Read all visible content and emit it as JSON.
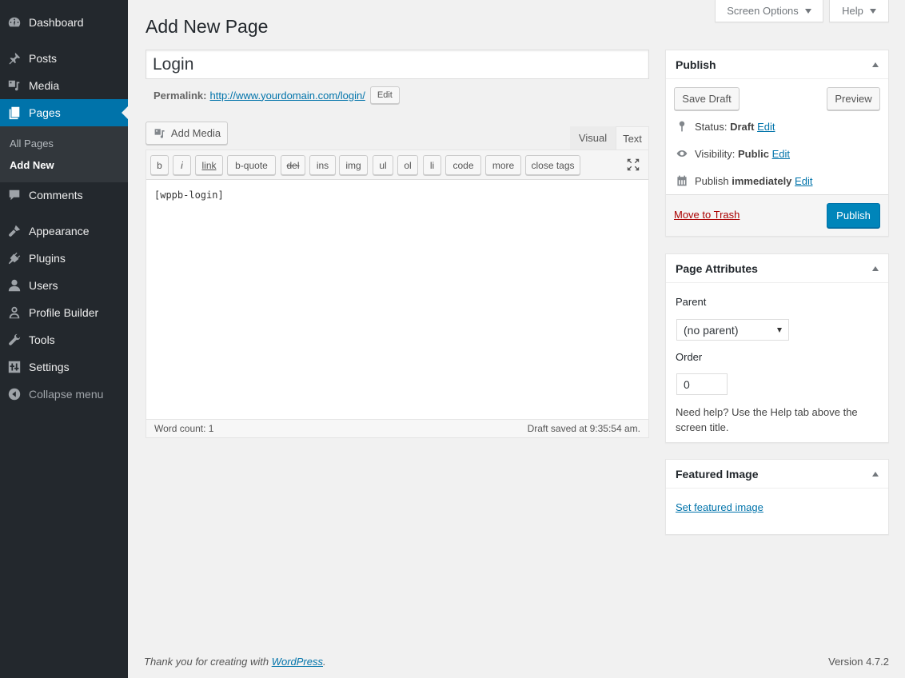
{
  "sidebar": {
    "items": [
      {
        "label": "Dashboard",
        "icon": "dashboard-icon"
      },
      {
        "label": "Posts",
        "icon": "pin-icon"
      },
      {
        "label": "Media",
        "icon": "media-icon"
      },
      {
        "label": "Pages",
        "icon": "pages-icon",
        "active": true
      },
      {
        "label": "Comments",
        "icon": "comment-icon"
      },
      {
        "label": "Appearance",
        "icon": "brush-icon"
      },
      {
        "label": "Plugins",
        "icon": "plugin-icon"
      },
      {
        "label": "Users",
        "icon": "user-icon"
      },
      {
        "label": "Profile Builder",
        "icon": "profile-icon"
      },
      {
        "label": "Tools",
        "icon": "wrench-icon"
      },
      {
        "label": "Settings",
        "icon": "settings-icon"
      },
      {
        "label": "Collapse menu",
        "icon": "collapse-icon"
      }
    ],
    "submenu": [
      {
        "label": "All Pages"
      },
      {
        "label": "Add New",
        "current": true
      }
    ]
  },
  "topbar": {
    "screen_options": "Screen Options",
    "help": "Help"
  },
  "page": {
    "title": "Add New Page",
    "post_title": "Login",
    "permalink_label": "Permalink:",
    "permalink_url": "http://www.yourdomain.com/login/",
    "permalink_edit": "Edit"
  },
  "editor": {
    "add_media": "Add Media",
    "tabs": {
      "visual": "Visual",
      "text": "Text"
    },
    "quicktags": [
      "b",
      "i",
      "link",
      "b-quote",
      "del",
      "ins",
      "img",
      "ul",
      "ol",
      "li",
      "code",
      "more",
      "close tags"
    ],
    "content": "[wppb-login]",
    "word_count": "Word count: 1",
    "draft_saved": "Draft saved at 9:35:54 am."
  },
  "publish": {
    "title": "Publish",
    "save_draft": "Save Draft",
    "preview": "Preview",
    "status_label": "Status:",
    "status_value": "Draft",
    "visibility_label": "Visibility:",
    "visibility_value": "Public",
    "schedule_label": "Publish",
    "schedule_value": "immediately",
    "edit": "Edit",
    "trash": "Move to Trash",
    "publish_button": "Publish"
  },
  "page_attributes": {
    "title": "Page Attributes",
    "parent_label": "Parent",
    "parent_value": "(no parent)",
    "order_label": "Order",
    "order_value": "0",
    "help": "Need help? Use the Help tab above the screen title."
  },
  "featured_image": {
    "title": "Featured Image",
    "link": "Set featured image"
  },
  "footer": {
    "thanks": "Thank you for creating with ",
    "wp_link": "WordPress",
    "period": ".",
    "version": "Version 4.7.2"
  },
  "colors": {
    "sidebar_bg": "#23282d",
    "accent": "#0073aa",
    "publish_button": "#0085ba",
    "trash": "#a00"
  }
}
